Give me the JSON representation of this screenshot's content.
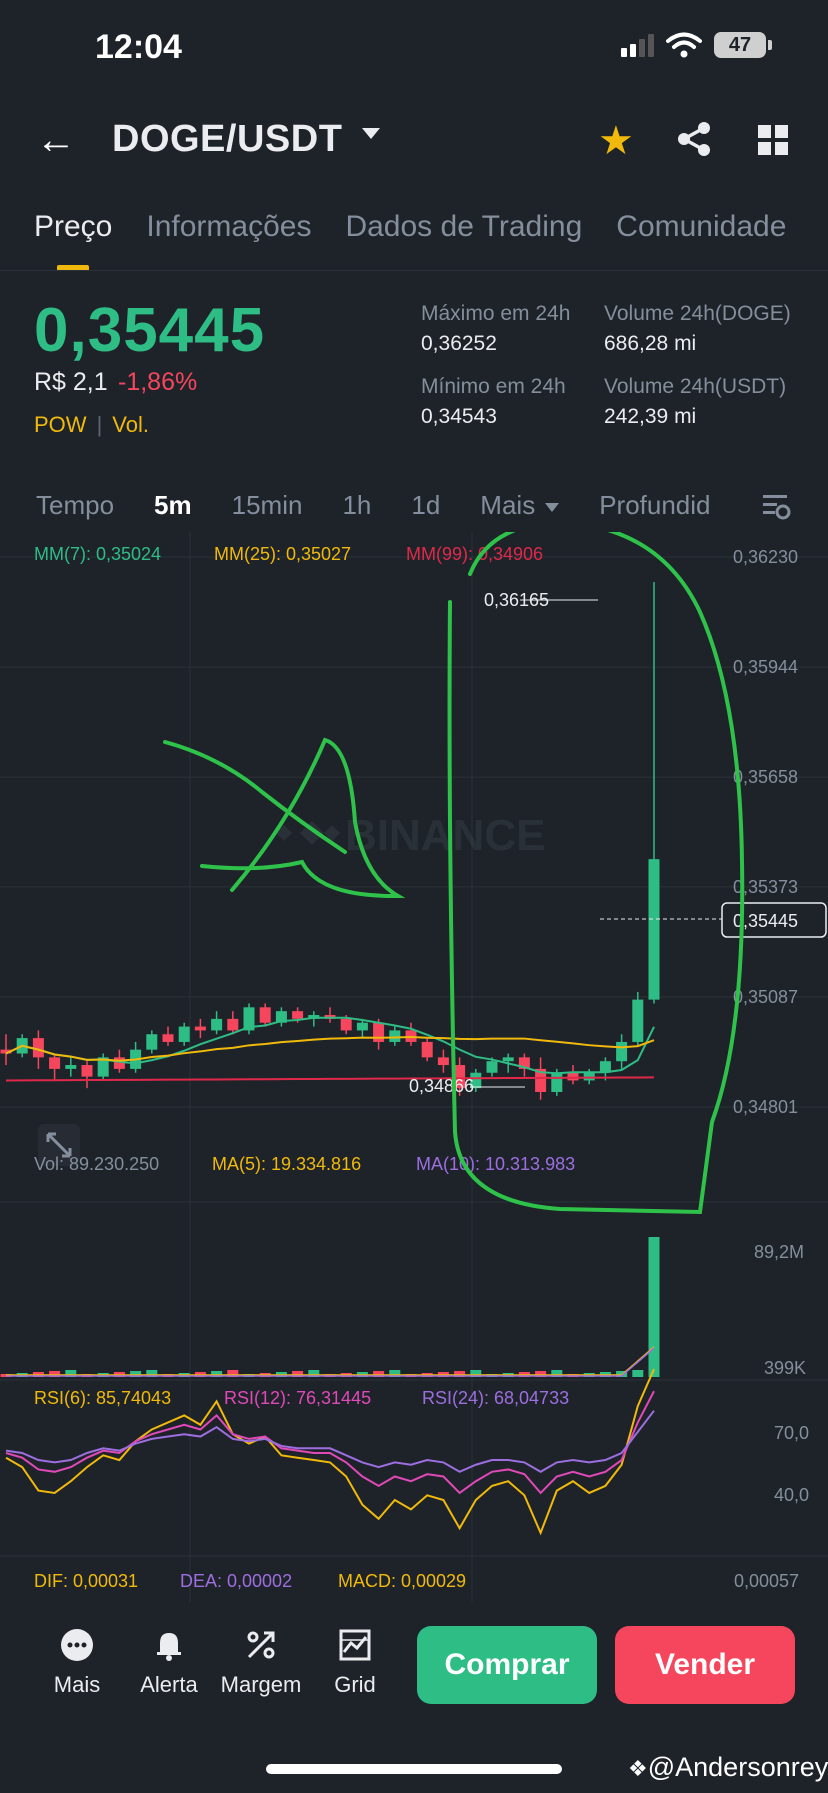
{
  "status_bar": {
    "time": "12:04",
    "battery": "47"
  },
  "header": {
    "pair": "DOGE/USDT"
  },
  "tabs": [
    {
      "label": "Preço",
      "active": true
    },
    {
      "label": "Informações",
      "active": false
    },
    {
      "label": "Dados de Trading",
      "active": false
    },
    {
      "label": "Comunidade",
      "active": false
    }
  ],
  "ticker": {
    "price": "0,35445",
    "fiat": "R$ 2,1",
    "change": "-1,86%",
    "tag1": "POW",
    "tag2": "Vol.",
    "high_label": "Máximo em 24h",
    "high_value": "0,36252",
    "low_label": "Mínimo em 24h",
    "low_value": "0,34543",
    "vol_doge_label": "Volume 24h(DOGE)",
    "vol_doge_value": "686,28 mi",
    "vol_usdt_label": "Volume 24h(USDT)",
    "vol_usdt_value": "242,39 mi"
  },
  "timeframes": {
    "items": [
      "Tempo",
      "5m",
      "15min",
      "1h",
      "1d",
      "Mais",
      "Profundid"
    ],
    "selected": "5m"
  },
  "colors": {
    "up": "#2ebd85",
    "down": "#f6465d",
    "accent": "#f0b90b",
    "bg": "#1e2329"
  },
  "chart_data": {
    "type": "candlestick",
    "ma_labels": {
      "ma7": "MM(7): 0,35024",
      "ma25": "MM(25): 0,35027",
      "ma99": "MM(99): 0,34906"
    },
    "y_ticks": [
      "0,36230",
      "0,35944",
      "0,35658",
      "0,35373",
      "0,35087",
      "0,34801"
    ],
    "y_tick_values": [
      0.3623,
      0.35944,
      0.35658,
      0.35373,
      0.35087,
      0.34801
    ],
    "last_price_label": "0,35445",
    "high_marker": "0,36165",
    "low_marker": "0,34866",
    "watermark": "BINANCE",
    "candles": [
      [
        0.3495,
        0.3499,
        0.3491,
        0.3494
      ],
      [
        0.3494,
        0.3499,
        0.3493,
        0.3498
      ],
      [
        0.3498,
        0.35,
        0.349,
        0.3493
      ],
      [
        0.3493,
        0.3494,
        0.3487,
        0.349
      ],
      [
        0.349,
        0.3493,
        0.3488,
        0.3491
      ],
      [
        0.3491,
        0.3492,
        0.3485,
        0.3488
      ],
      [
        0.3488,
        0.3494,
        0.3487,
        0.3493
      ],
      [
        0.3493,
        0.3495,
        0.3489,
        0.349
      ],
      [
        0.349,
        0.3497,
        0.3489,
        0.3495
      ],
      [
        0.3495,
        0.35,
        0.3494,
        0.3499
      ],
      [
        0.3499,
        0.3501,
        0.3496,
        0.3497
      ],
      [
        0.3497,
        0.3502,
        0.3496,
        0.3501
      ],
      [
        0.3501,
        0.3503,
        0.3498,
        0.35
      ],
      [
        0.35,
        0.3505,
        0.3499,
        0.3503
      ],
      [
        0.3503,
        0.3505,
        0.3499,
        0.35
      ],
      [
        0.35,
        0.3507,
        0.3499,
        0.3506
      ],
      [
        0.3506,
        0.3507,
        0.3501,
        0.3502
      ],
      [
        0.3502,
        0.3506,
        0.3501,
        0.3505
      ],
      [
        0.3505,
        0.3506,
        0.3502,
        0.3503
      ],
      [
        0.3503,
        0.3505,
        0.3501,
        0.3504
      ],
      [
        0.3504,
        0.3506,
        0.3502,
        0.3503
      ],
      [
        0.3503,
        0.3504,
        0.3499,
        0.35
      ],
      [
        0.35,
        0.3503,
        0.3498,
        0.3502
      ],
      [
        0.3502,
        0.3503,
        0.3495,
        0.3497
      ],
      [
        0.3497,
        0.3501,
        0.3496,
        0.35
      ],
      [
        0.35,
        0.3502,
        0.3496,
        0.3497
      ],
      [
        0.3497,
        0.3498,
        0.3492,
        0.3493
      ],
      [
        0.3493,
        0.3495,
        0.3489,
        0.3491
      ],
      [
        0.3491,
        0.3493,
        0.3483,
        0.3485
      ],
      [
        0.3485,
        0.349,
        0.3484,
        0.3489
      ],
      [
        0.3489,
        0.3493,
        0.3488,
        0.3492
      ],
      [
        0.3492,
        0.3494,
        0.3489,
        0.3493
      ],
      [
        0.3493,
        0.3494,
        0.3488,
        0.349
      ],
      [
        0.349,
        0.3493,
        0.3482,
        0.3484
      ],
      [
        0.3484,
        0.349,
        0.3483,
        0.3489
      ],
      [
        0.3489,
        0.3491,
        0.3486,
        0.3487
      ],
      [
        0.3487,
        0.349,
        0.3486,
        0.3489
      ],
      [
        0.3489,
        0.3493,
        0.3487,
        0.3492
      ],
      [
        0.3492,
        0.3499,
        0.349,
        0.3497
      ],
      [
        0.3497,
        0.351,
        0.3496,
        0.3508
      ],
      [
        0.3508,
        0.36165,
        0.3507,
        0.35445
      ]
    ],
    "volume": {
      "label": "Vol: 89.230.250",
      "ma5": "MA(5): 19.334.816",
      "ma10": "MA(10): 10.313.983",
      "axis_top": "89,2M",
      "axis_bottom": "399K",
      "last_value": 89.2
    },
    "rsi": {
      "rsi6": "RSI(6): 85,74043",
      "rsi12": "RSI(12): 76,31445",
      "rsi24": "RSI(24): 68,04733",
      "levels": [
        "70,0",
        "40,0"
      ]
    },
    "macd": {
      "dif": "DIF: 0,00031",
      "dea": "DEA: 0,00002",
      "macd": "MACD: 0,00029",
      "axis": "0,00057"
    }
  },
  "bottom_bar": {
    "more": "Mais",
    "alert": "Alerta",
    "margin": "Margem",
    "grid": "Grid",
    "buy": "Comprar",
    "sell": "Vender"
  },
  "credit": "@Andersonrey"
}
